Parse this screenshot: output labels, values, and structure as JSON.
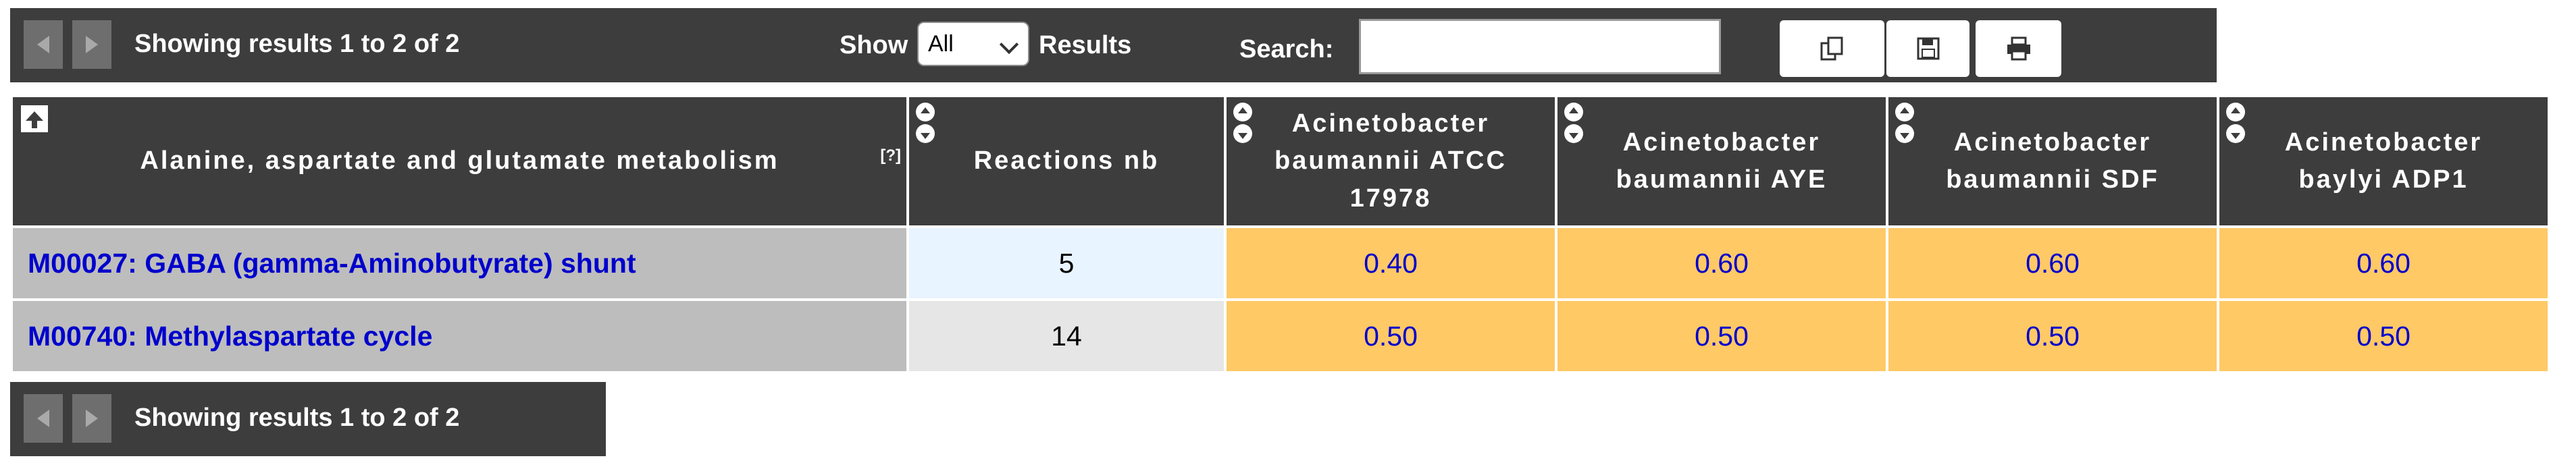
{
  "top_toolbar": {
    "status_text": "Showing results 1 to 2 of 2",
    "show_label": "Show",
    "show_selected": "All",
    "results_label": "Results",
    "search_label": "Search:",
    "search_value": "",
    "icons": [
      "copy-icon",
      "save-icon",
      "print-icon"
    ]
  },
  "bottom_toolbar": {
    "status_text": "Showing results 1 to 2 of 2"
  },
  "table": {
    "columns": [
      {
        "label": "Alanine, aspartate and glutamate metabolism",
        "help": "[?]"
      },
      {
        "label": "Reactions nb"
      },
      {
        "label": "Acinetobacter baumannii ATCC 17978"
      },
      {
        "label": "Acinetobacter baumannii AYE"
      },
      {
        "label": "Acinetobacter baumannii SDF"
      },
      {
        "label": "Acinetobacter baylyi ADP1"
      }
    ],
    "rows": [
      {
        "name": "M00027: GABA (gamma-Aminobutyrate) shunt",
        "reactions": "5",
        "values": [
          "0.40",
          "0.60",
          "0.60",
          "0.60"
        ]
      },
      {
        "name": "M00740: Methylaspartate cycle",
        "reactions": "14",
        "values": [
          "0.50",
          "0.50",
          "0.50",
          "0.50"
        ]
      }
    ]
  },
  "colors": {
    "toolbar_bg": "#3d3d3d",
    "header_bg": "#3d3d3d",
    "value_cell_bg": "#ffc966",
    "name_cell_bg": "#bdbdbd",
    "link_color": "#0000cc"
  }
}
